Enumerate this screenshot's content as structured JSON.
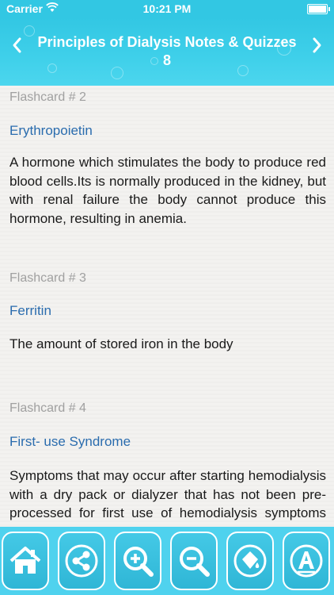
{
  "status_bar": {
    "carrier": "Carrier",
    "time": "10:21 PM"
  },
  "header": {
    "title": "Principles of Dialysis Notes & Quizzes 8",
    "prev_icon": "chevron-left-icon",
    "next_icon": "chevron-right-icon"
  },
  "flashcards": [
    {
      "number": "Flashcard # 2",
      "term": "Erythropoietin",
      "definition": "A hormone which stimulates the body to produce red blood cells.Its is normally produced in the kidney, but with renal failure the body cannot produce this hormone, resulting in anemia."
    },
    {
      "number": "Flashcard # 3",
      "term": "Ferritin",
      "definition": "The amount of stored iron in the body"
    },
    {
      "number": "Flashcard # 4",
      "term": "First- use Syndrome",
      "definition": "Symptoms that may occur after starting hemodialysis with a dry pack or dialyzer that has not been pre-processed for first use of hemodialysis symptoms may include chest pain,"
    }
  ],
  "toolbar": {
    "buttons": [
      "home-icon",
      "share-icon",
      "zoom-in-icon",
      "zoom-out-icon",
      "paint-bucket-icon",
      "font-icon"
    ]
  },
  "colors": {
    "header_bg": "#32c7e3",
    "term_text": "#2a6cae",
    "card_number_text": "#a0a0a0",
    "toolbar_bg": "#4fd2ee"
  }
}
